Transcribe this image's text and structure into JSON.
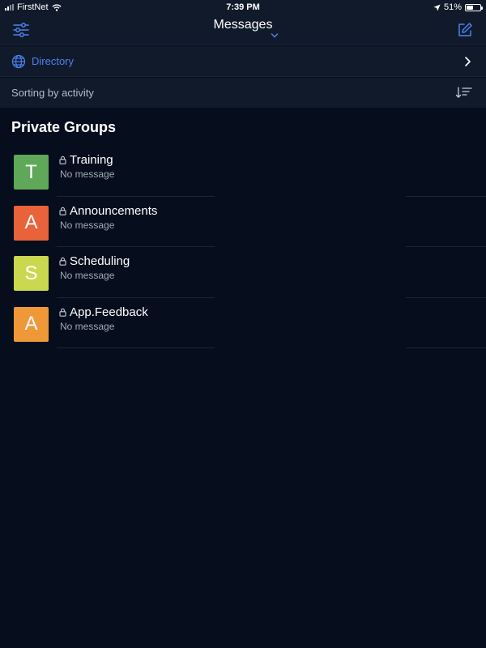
{
  "status_bar": {
    "carrier": "FirstNet",
    "time": "7:39 PM",
    "battery": "51%",
    "battery_level": 0.51
  },
  "nav": {
    "title": "Messages",
    "left_icon": "sliders-icon",
    "right_icon": "compose-icon"
  },
  "directory": {
    "label": "Directory",
    "icon": "globe-icon"
  },
  "sorting": {
    "label": "Sorting by activity",
    "icon": "sort-icon"
  },
  "section": {
    "title": "Private Groups"
  },
  "groups": [
    {
      "initial": "T",
      "name": "Training",
      "subtitle": "No message",
      "color": "#5fa85a"
    },
    {
      "initial": "A",
      "name": "Announcements",
      "subtitle": "No message",
      "color": "#e8623a"
    },
    {
      "initial": "S",
      "name": "Scheduling",
      "subtitle": "No message",
      "color": "#c9d84e"
    },
    {
      "initial": "A",
      "name": "App.Feedback",
      "subtitle": "No message",
      "color": "#ee9838"
    }
  ],
  "colors": {
    "accent": "#4c82f0",
    "background": "#060d1d",
    "bar": "#111a2b"
  }
}
